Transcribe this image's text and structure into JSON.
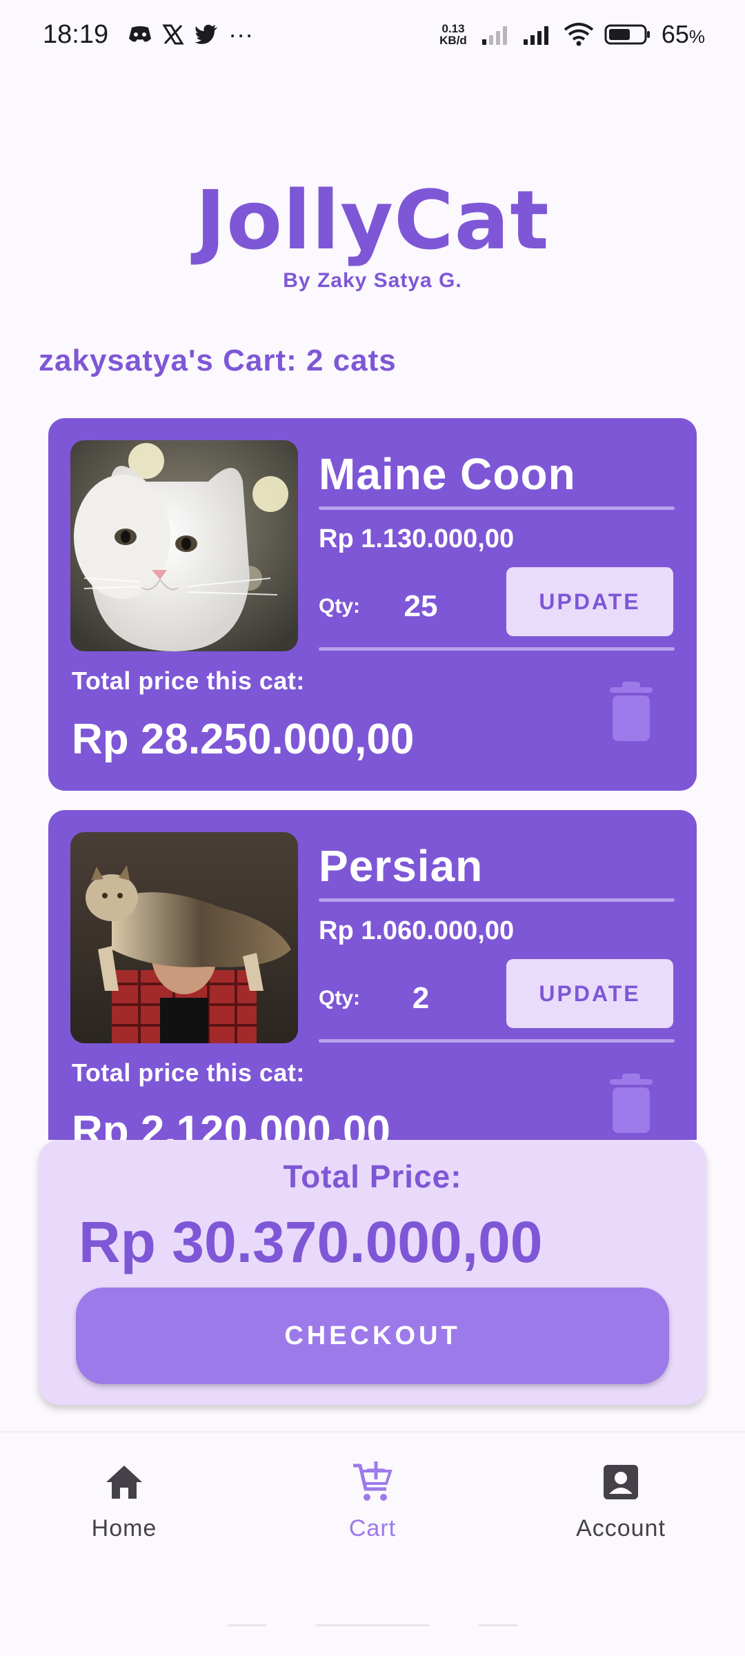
{
  "status_bar": {
    "time": "18:19",
    "net_speed_value": "0.13",
    "net_speed_unit": "KB/d",
    "battery": "65",
    "battery_unit": "%",
    "more": "···",
    "icons": [
      "discord-icon",
      "x-icon",
      "twitter-icon",
      "signal-icon",
      "signal-icon",
      "wifi-icon",
      "battery-icon"
    ]
  },
  "header": {
    "title": "JollyCat",
    "subtitle": "By Zaky Satya G.",
    "cart_heading": "zakysatya's Cart: 2 cats"
  },
  "cart": {
    "items": [
      {
        "name": "Maine Coon",
        "price": "Rp 1.130.000,00",
        "qty_label": "Qty:",
        "qty": "25",
        "update_label": "UPDATE",
        "total_label": "Total price this cat:",
        "total": "Rp 28.250.000,00"
      },
      {
        "name": "Persian",
        "price": "Rp 1.060.000,00",
        "qty_label": "Qty:",
        "qty": "2",
        "update_label": "UPDATE",
        "total_label": "Total price this cat:",
        "total": "Rp 2.120.000,00"
      }
    ]
  },
  "checkout": {
    "label": "Total Price:",
    "value": "Rp 30.370.000,00",
    "button_label": "CHECKOUT"
  },
  "nav": {
    "items": [
      {
        "label": "Home",
        "icon": "home-icon"
      },
      {
        "label": "Cart",
        "icon": "cart-icon",
        "active": true
      },
      {
        "label": "Account",
        "icon": "account-icon"
      }
    ]
  },
  "colors": {
    "primary": "#7e57d6",
    "primary_light": "#9d7ae9",
    "surface_tint": "#e9dafb",
    "background": "#fbf8fe"
  }
}
